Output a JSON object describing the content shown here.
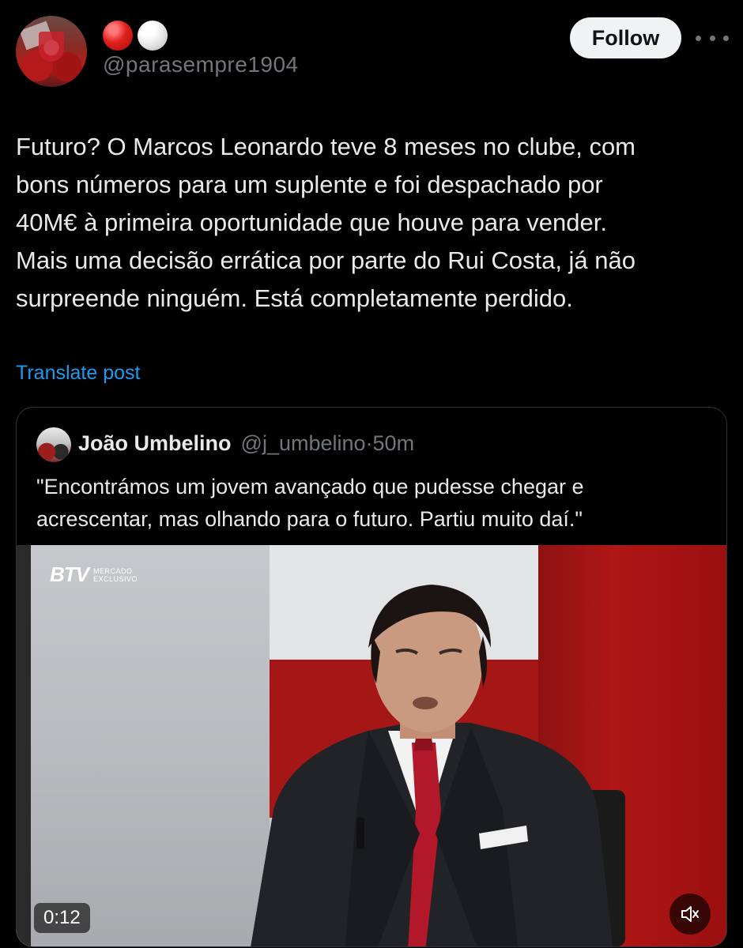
{
  "author": {
    "emoji_status": [
      "red-circle",
      "white-circle"
    ],
    "handle": "@parasempre1904"
  },
  "actions": {
    "follow_label": "Follow",
    "more_icon": "more-horizontal-icon"
  },
  "post": {
    "text": "Futuro? O Marcos Leonardo teve 8 meses no clube, com\nbons números para um suplente e foi despachado por\n40M€ à primeira oportunidade que houve para vender.\nMais uma decisão errática por parte do Rui Costa, já não\nsurpreende ninguém. Está completamente perdido.",
    "translate_label": "Translate post"
  },
  "quoted_post": {
    "author_name": "João Umbelino",
    "author_handle": "@j_umbelino",
    "separator": "·",
    "time": "50m",
    "text": "\"Encontrámos um jovem avançado que pudesse chegar e\nacrescentar, mas olhando para o futuro. Partiu muito daí.\"",
    "video": {
      "channel_logo": "BTV",
      "channel_tag_line1": "MERCADO",
      "channel_tag_line2": "EXCLUSIVO",
      "elapsed": "0:12",
      "mute_icon": "speaker-muted-icon"
    }
  },
  "colors": {
    "background": "#000000",
    "text": "#e7e9ea",
    "secondary": "#71767b",
    "link": "#1d9bf0",
    "border": "#2f3336",
    "follow_bg": "#eff3f4"
  }
}
